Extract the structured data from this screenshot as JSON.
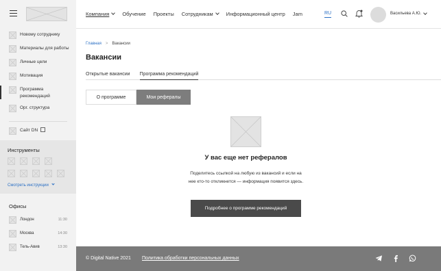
{
  "sidebar": {
    "nav": [
      {
        "label": "Новому сотруднику"
      },
      {
        "label": "Материалы для работы"
      },
      {
        "label": "Личные цели"
      },
      {
        "label": "Мотивация"
      },
      {
        "label": "Программа рекомендаций"
      },
      {
        "label": "Орг. структура"
      },
      {
        "label": "Сайт DN"
      }
    ],
    "tools_title": "Инструменты",
    "tools_link": "Смотреть инструкции",
    "offices_title": "Офисы",
    "offices": [
      {
        "label": "Лондон",
        "time": "11:30"
      },
      {
        "label": "Москва",
        "time": "14:30"
      },
      {
        "label": "Тель-Авив",
        "time": "13:30"
      }
    ]
  },
  "header": {
    "nav": [
      "Компания",
      "Обучение",
      "Проекты",
      "Сотрудникам",
      "Информационный центр",
      "Jam"
    ],
    "lang": "RU",
    "user": "Васильева А.Ю."
  },
  "main": {
    "crumb_home": "Главная",
    "crumb_sep": ">",
    "crumb_current": "Вакансии",
    "title": "Вакансии",
    "tabs": [
      "Открытые вакансии",
      "Программа рекомендаций"
    ],
    "seg": [
      "О программе",
      "Мои рефералы"
    ],
    "empty_title": "У вас еще нет рефералов",
    "empty_desc": "Поделитесь ссылкой на любую из вакансий и если на нее кто-то откликнется — информация появится здесь.",
    "cta": "Подробнее о программе рекомендаций"
  },
  "footer": {
    "copyright": "© Digital Native 2021",
    "policy": "Политика обработки персональных данных"
  },
  "colors": {
    "link": "#2a6fc4",
    "footer_bg": "#7a7a7a",
    "cta_bg": "#4a4a4a",
    "seg_active_bg": "#7d7d7d",
    "sidebar_bg": "#f2f2f2"
  }
}
